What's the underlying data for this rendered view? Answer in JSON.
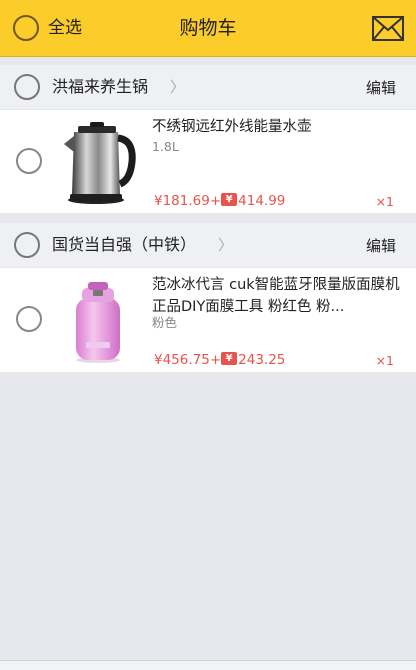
{
  "header": {
    "select_all_label": "全选",
    "title": "购物车",
    "message_icon": "envelope-icon",
    "background_color": "#fccc2a"
  },
  "stores": [
    {
      "name": "洪福来养生锅",
      "chevron": "〉",
      "edit_label": "编辑",
      "item": {
        "title": "不绣钢远红外线能量水壶",
        "spec": "1.8L",
        "price_cash": "¥181.69+",
        "price_points": "414.99",
        "quantity": "×1",
        "thumbnail": "kettle-image"
      }
    },
    {
      "name": "国货当自强（中铁）",
      "chevron": "〉",
      "edit_label": "编辑",
      "item": {
        "title": "范冰冰代言 cuk智能蓝牙限量版面膜机正品DIY面膜工具 粉红色 粉...",
        "spec": "粉色",
        "price_cash": "¥456.75+",
        "price_points": "243.25",
        "quantity": "×1",
        "thumbnail": "mask-machine-image"
      }
    }
  ],
  "colors": {
    "price_red": "#e8534d",
    "page_bg": "#e6e8ed"
  }
}
